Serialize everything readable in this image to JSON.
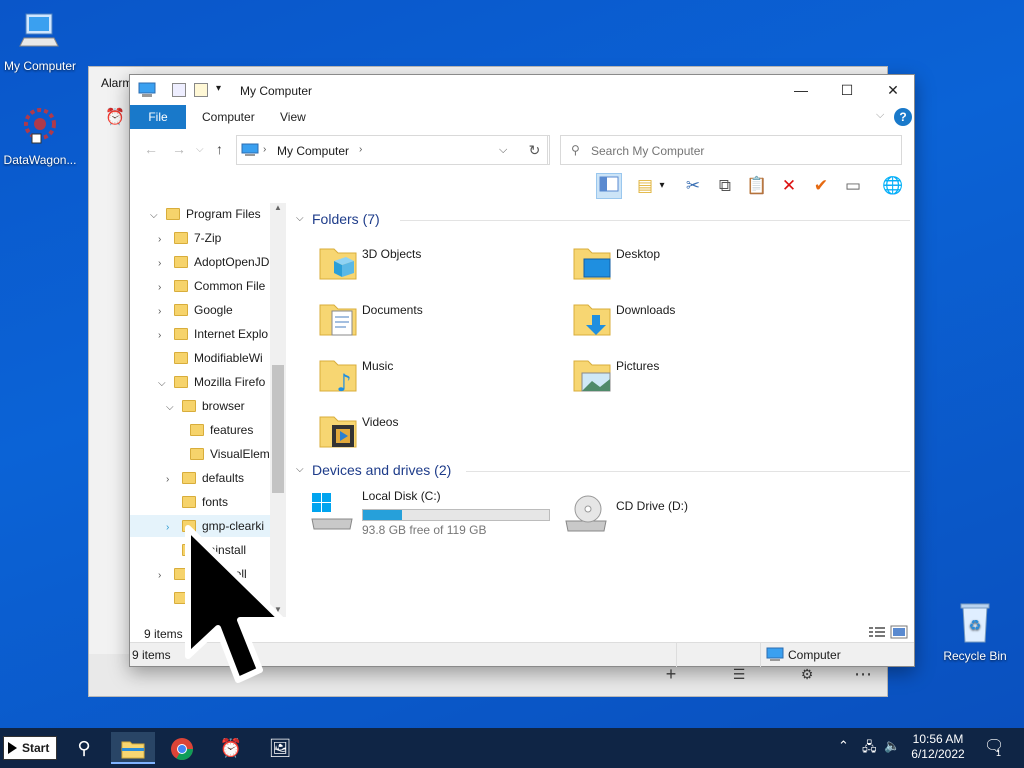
{
  "desktop": {
    "icons": [
      {
        "label": "My Computer"
      },
      {
        "label": "DataWagon..."
      },
      {
        "label": "Recycle Bin"
      }
    ]
  },
  "alarms": {
    "title": "Alarm"
  },
  "explorer": {
    "title": "My Computer",
    "ribbon_tabs": [
      "File",
      "Computer",
      "View"
    ],
    "address": "My Computer",
    "search_placeholder": "Search My Computer",
    "tree": [
      {
        "label": "Program Files",
        "expanded": true
      },
      {
        "label": "7-Zip"
      },
      {
        "label": "AdoptOpenJD"
      },
      {
        "label": "Common File"
      },
      {
        "label": "Google"
      },
      {
        "label": "Internet Explo"
      },
      {
        "label": "ModifiableWi"
      },
      {
        "label": "Mozilla Firefo"
      },
      {
        "label": "browser"
      },
      {
        "label": "features"
      },
      {
        "label": "VisualElem"
      },
      {
        "label": "defaults"
      },
      {
        "label": "fonts"
      },
      {
        "label": "gmp-clearki"
      },
      {
        "label": "uninstall"
      },
      {
        "label": "-Shell"
      },
      {
        "label": "dio"
      }
    ],
    "folders_header": "Folders (7)",
    "folders": [
      "3D Objects",
      "Desktop",
      "Documents",
      "Downloads",
      "Music",
      "Pictures",
      "Videos"
    ],
    "drives_header": "Devices and drives (2)",
    "drives": [
      {
        "name": "Local Disk (C:)",
        "free_text": "93.8 GB free of 119 GB",
        "used_fraction": 0.21
      },
      {
        "name": "CD Drive (D:)"
      }
    ],
    "inner_status": "9 items",
    "status_left": "9 items",
    "status_right": "Computer"
  },
  "taskbar": {
    "start": "Start",
    "time": "10:56 AM",
    "date": "6/12/2022",
    "notif_count": "1"
  },
  "colors": {
    "desktop_blue": "#0b63d6",
    "ribbon_file": "#1979ca",
    "group_header": "#1e3c8a",
    "drive_fill": "#26a0da"
  }
}
